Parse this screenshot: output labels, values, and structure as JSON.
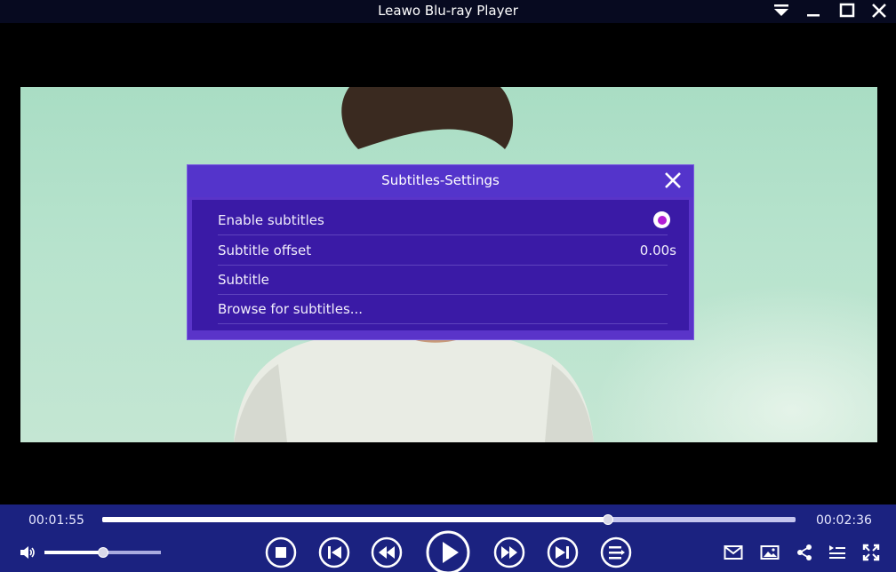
{
  "window": {
    "title": "Leawo Blu-ray Player",
    "buttons": [
      "menu-icon",
      "minimize-icon",
      "maximize-icon",
      "close-icon"
    ]
  },
  "dialog": {
    "title": "Subtitles-Settings",
    "rows": [
      {
        "label": "Enable subtitles",
        "control": "radio",
        "checked": true
      },
      {
        "label": "Subtitle offset",
        "value": "0.00s"
      },
      {
        "label": "Subtitle"
      },
      {
        "label": "Browse for subtitles..."
      }
    ]
  },
  "player": {
    "elapsed": "00:01:55",
    "total": "00:02:36",
    "progress_fraction": 0.73,
    "volume_fraction": 0.5
  },
  "controls": {
    "center": [
      "stop-icon",
      "previous-icon",
      "rewind-icon",
      "play-icon",
      "fast-forward-icon",
      "next-icon",
      "playlist-icon"
    ],
    "right": [
      "mail-icon",
      "snapshot-icon",
      "share-icon",
      "subtitle-list-icon",
      "fullscreen-icon"
    ],
    "left": [
      "volume-icon"
    ]
  },
  "colors": {
    "titlebar": "#070a20",
    "controlbar": "#1b2280",
    "dialog_header": "#5434cb",
    "dialog_body": "#3a1aa6",
    "radio_dot": "#b21fd6"
  }
}
